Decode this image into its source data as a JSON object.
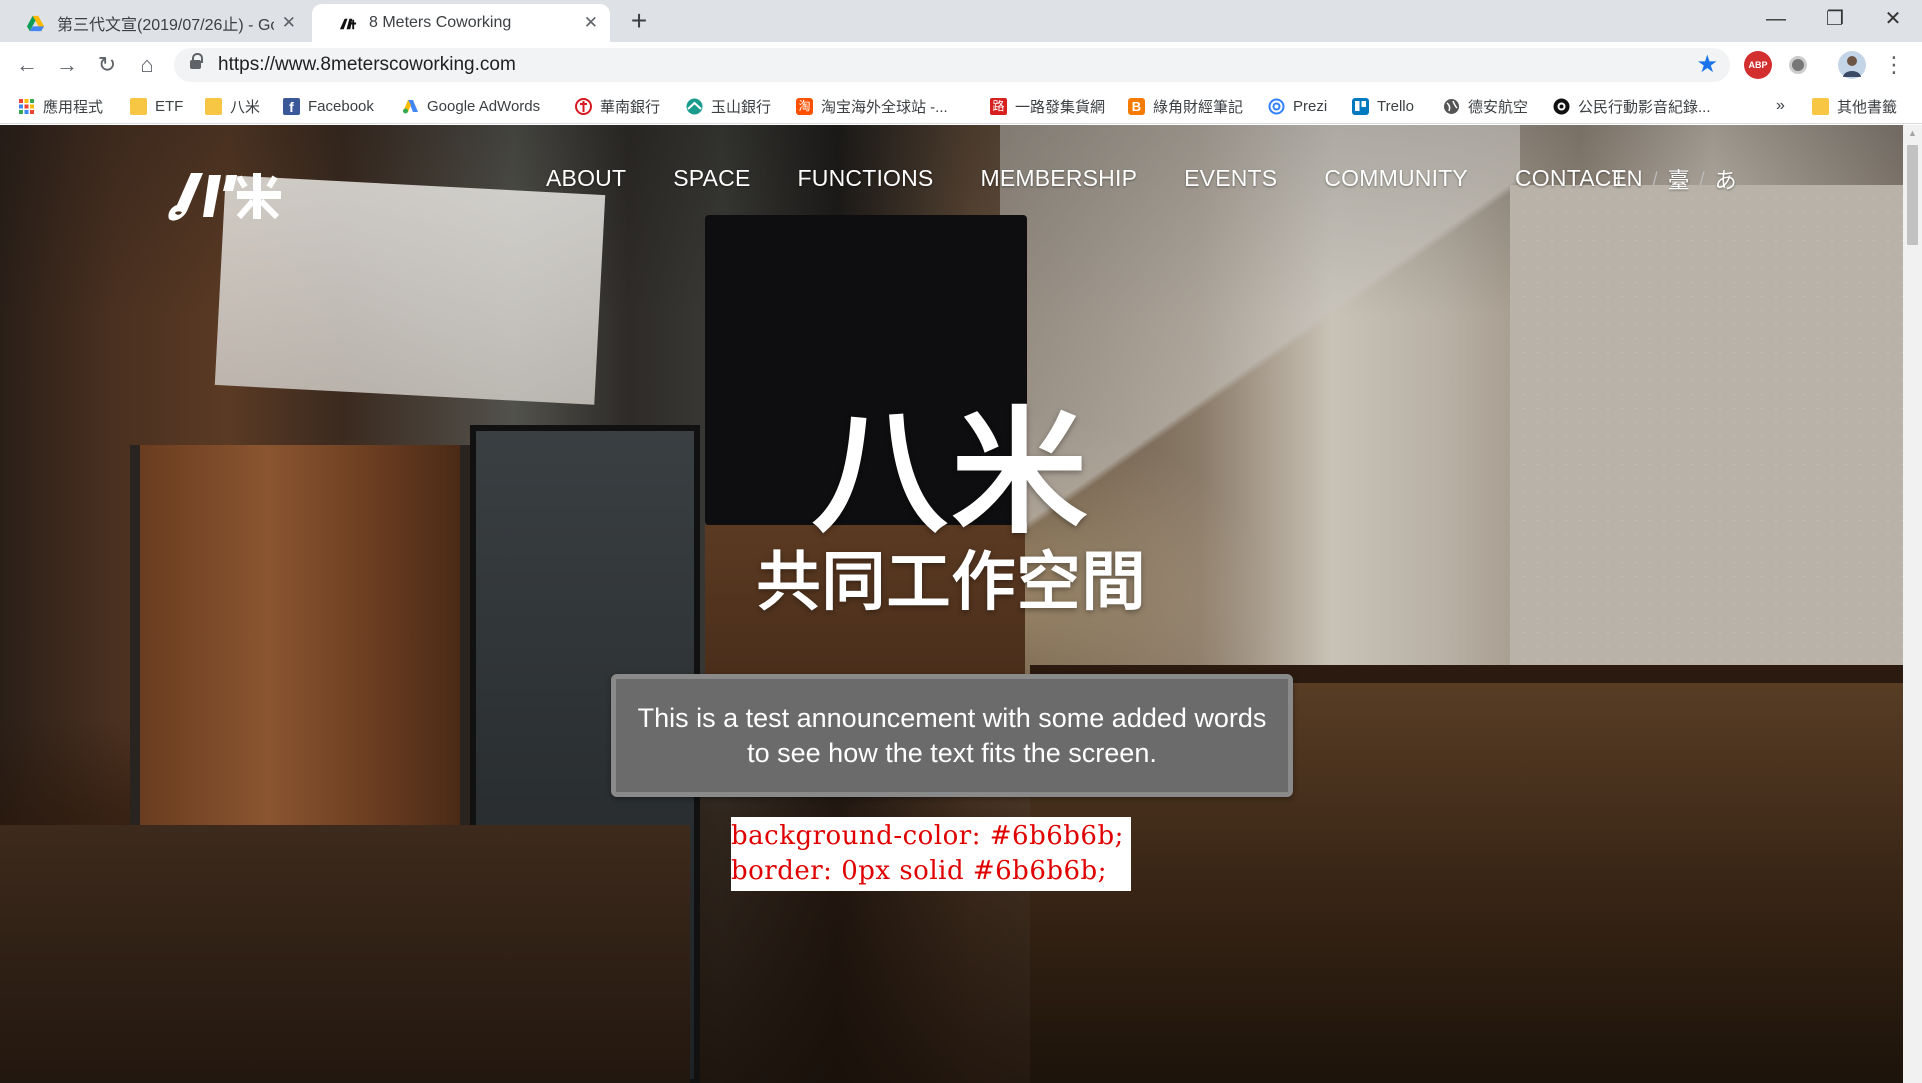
{
  "browser": {
    "tabs": [
      {
        "title": "第三代文宣(2019/07/26止) - Go",
        "icon": "google-drive-icon",
        "active": false
      },
      {
        "title": "8 Meters Coworking",
        "icon": "8meters-favicon",
        "active": true
      }
    ],
    "new_tab_label": "+",
    "window_controls": {
      "minimize": "—",
      "restore": "❐",
      "close": "✕"
    },
    "url": "https://www.8meterscoworking.com",
    "nav": {
      "back": "←",
      "forward": "→",
      "reload": "↻",
      "home": "⌂"
    },
    "star": "★",
    "menu_dots": "⋮",
    "abp_label": "ABP",
    "bookmarks": [
      {
        "label": "應用程式",
        "icon": "apps-grid-icon"
      },
      {
        "label": "ETF",
        "icon": "folder-icon"
      },
      {
        "label": "八米",
        "icon": "folder-icon"
      },
      {
        "label": "Facebook",
        "icon": "facebook-icon"
      },
      {
        "label": "Google AdWords",
        "icon": "adwords-icon"
      },
      {
        "label": "華南銀行",
        "icon": "hua-nan-bank-icon"
      },
      {
        "label": "玉山銀行",
        "icon": "esun-bank-icon"
      },
      {
        "label": "淘宝海外全球站 -...",
        "icon": "taobao-icon"
      },
      {
        "label": "一路發集貨網",
        "icon": "yilufa-icon"
      },
      {
        "label": "綠角財經筆記",
        "icon": "blogger-icon"
      },
      {
        "label": "Prezi",
        "icon": "prezi-icon"
      },
      {
        "label": "Trello",
        "icon": "trello-icon"
      },
      {
        "label": "德安航空",
        "icon": "globe-icon"
      },
      {
        "label": "公民行動影音紀錄...",
        "icon": "civil-media-icon"
      }
    ],
    "bookmarks_overflow": "»",
    "other_bookmarks": "其他書籤"
  },
  "site": {
    "nav": [
      "ABOUT",
      "SPACE",
      "FUNCTIONS",
      "MEMBERSHIP",
      "EVENTS",
      "COMMUNITY",
      "CONTACT"
    ],
    "languages": [
      "EN",
      "臺",
      "あ"
    ],
    "lang_separator": "/",
    "hero_title": "八米",
    "hero_subtitle": "共同工作空間",
    "announcement": "This is a test announcement with some added words to see how the text fits the screen.",
    "css_note": [
      "background-color: #6b6b6b;",
      "border: 0px solid #6b6b6b;"
    ]
  },
  "colors": {
    "announcement_bg": "#6b6b6b",
    "css_note_text": "#e00000",
    "star_blue": "#1a73e8"
  }
}
